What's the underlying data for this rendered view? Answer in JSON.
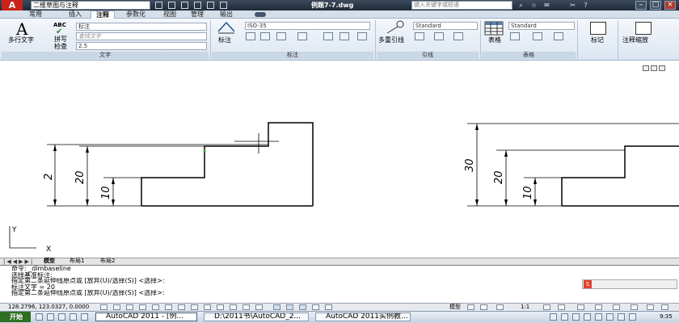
{
  "app": {
    "logo_letter": "A",
    "workspace": "二维草图与注释",
    "document_title": "例题7-7.dwg",
    "search_placeholder": "键入关键字或短语",
    "min": "–",
    "max": "□",
    "close": "×"
  },
  "ribbon_tabs": [
    "常用",
    "插入",
    "注释",
    "参数化",
    "视图",
    "管理",
    "输出"
  ],
  "active_tab": "注释",
  "text_panel": {
    "mtext_label": "多行文字",
    "spell_icon_text": "ABC",
    "spell_label": "拼写\n检查",
    "style_combo": "标注",
    "find_placeholder": "查找文字",
    "height_combo": "2.5",
    "panel_title": "文字"
  },
  "dimension_panel": {
    "dim_label": "标注",
    "style_combo": "ISO-35",
    "panel_title": "标注"
  },
  "leader_panel": {
    "mleader_label": "多重引线",
    "style_combo": "Standard",
    "panel_title": "引线"
  },
  "table_panel": {
    "table_label": "表格",
    "style_combo": "Standard",
    "panel_title": "表格"
  },
  "markup_panel": {
    "label": "标记"
  },
  "annoscale_panel": {
    "label": "注释缩放"
  },
  "drawing": {
    "left_dims": [
      "20",
      "10"
    ],
    "left_dim_partial": "2",
    "right_dims": [
      "30",
      "20",
      "10"
    ],
    "ucs_y": "Y",
    "ucs_x": "X"
  },
  "layout_tabs": [
    "模型",
    "布局1",
    "布局2"
  ],
  "command_lines": [
    "命令:  _dimbaseline",
    "选择基准标注:",
    "指定第二条延伸线原点或 [放弃(U)/选择(S)] <选择>:",
    "标注文字 = 20",
    "指定第二条延伸线原点或 [放弃(U)/选择(S)] <选择>:"
  ],
  "status": {
    "coords": "128.2796, 123.0327, 0.0000",
    "model": "模型",
    "scale": "1:1"
  },
  "taskbar": {
    "start": "开始",
    "tasks": [
      "AutoCAD 2011 - [例...",
      "D:\\2011书\\AutoCAD_2...",
      "AutoCAD 2011实例教..."
    ],
    "clock": "9:35"
  }
}
